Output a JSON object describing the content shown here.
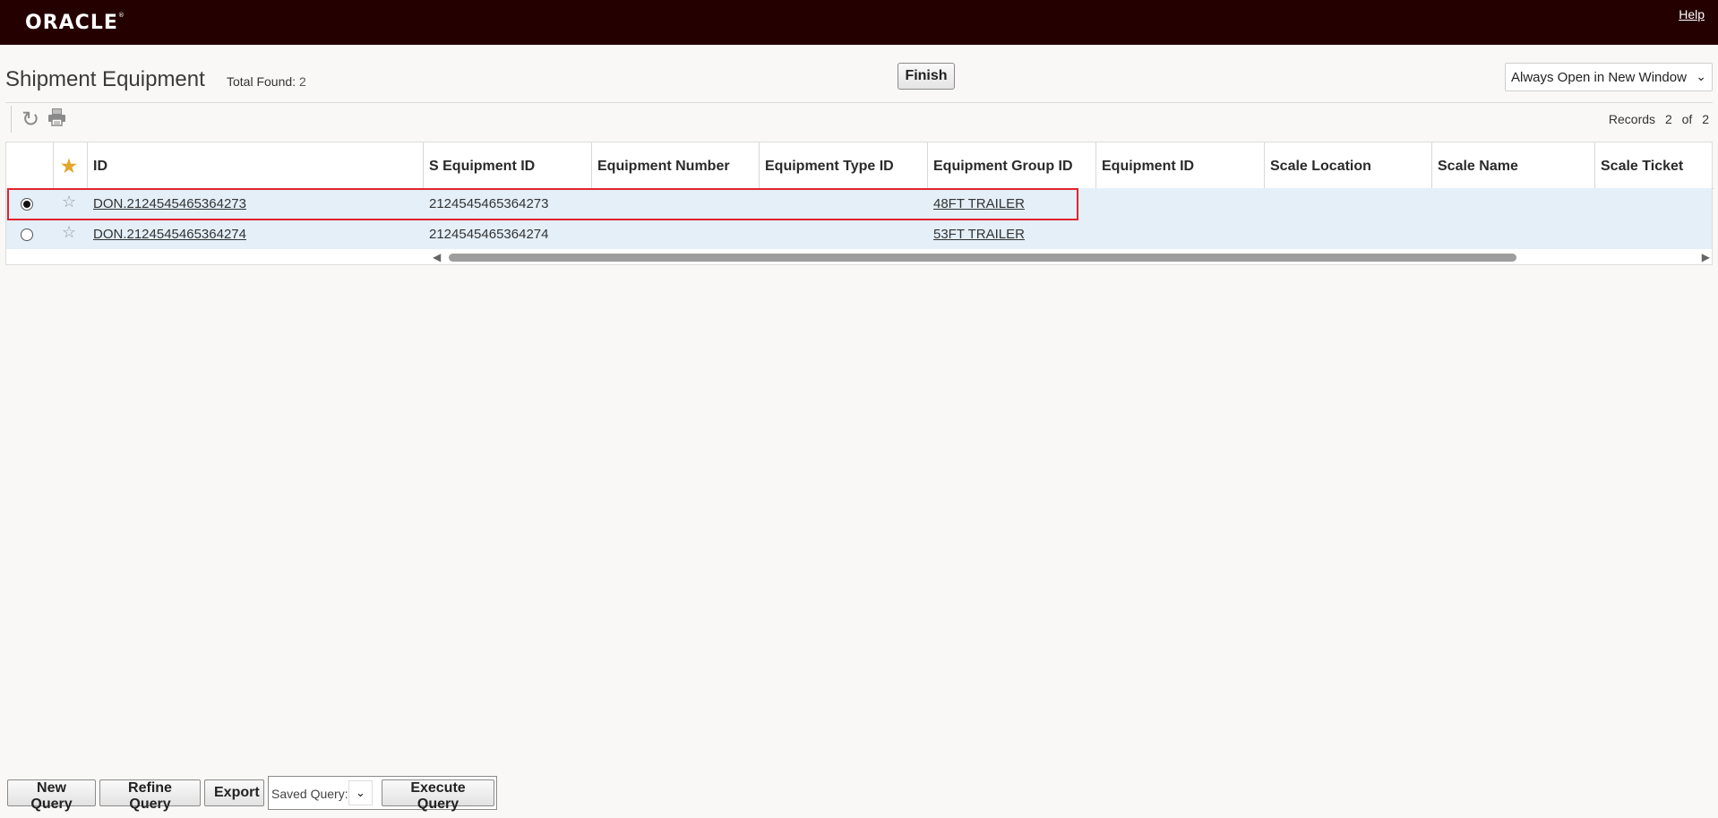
{
  "header": {
    "logo": "ORACLE",
    "help": "Help"
  },
  "page": {
    "title": "Shipment Equipment",
    "total_found_label": "Total Found:",
    "total_found": "2",
    "finish": "Finish",
    "open_mode": "Always Open in New Window",
    "records_label": "Records",
    "records_current": "2",
    "records_of": "of",
    "records_total": "2"
  },
  "table": {
    "columns": [
      "ID",
      "S Equipment ID",
      "Equipment Number",
      "Equipment Type ID",
      "Equipment Group ID",
      "Equipment ID",
      "Scale Location",
      "Scale Name",
      "Scale Ticket"
    ],
    "rows": [
      {
        "selected": true,
        "id": "DON.2124545465364273",
        "s_equipment_id": "2124545465364273",
        "equipment_number": "",
        "equipment_type_id": "",
        "equipment_group_id": "48FT TRAILER"
      },
      {
        "selected": false,
        "id": "DON.2124545465364274",
        "s_equipment_id": "2124545465364274",
        "equipment_number": "",
        "equipment_type_id": "",
        "equipment_group_id": "53FT TRAILER"
      }
    ]
  },
  "footer": {
    "new_query": "New Query",
    "refine_query": "Refine Query",
    "export": "Export",
    "saved_query_label": "Saved Query:",
    "execute_query": "Execute Query"
  },
  "icons": {
    "refresh": "refresh-icon",
    "print": "print-icon",
    "star": "star-icon"
  },
  "colors": {
    "header_bg": "#250000",
    "row_bg": "#e4eff8",
    "link": "#1f5f9e",
    "highlight": "#e0242f",
    "favorite": "#e3a52c"
  }
}
